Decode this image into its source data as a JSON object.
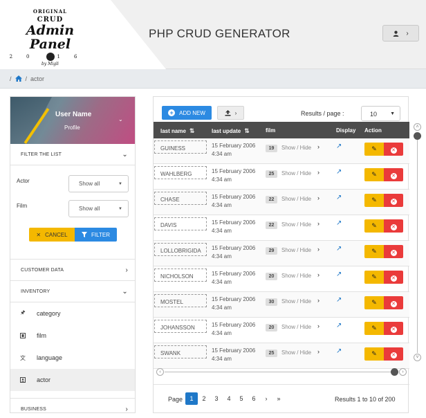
{
  "logo": {
    "top": "ORIGINAL",
    "crud": "CRUD",
    "admin": "Admin Panel",
    "year_left": "20",
    "year_right": "16",
    "by": "by Migli"
  },
  "header": {
    "title": "PHP CRUD GENERATOR",
    "user_icon": "user-icon",
    "arrow": "›"
  },
  "breadcrumb": {
    "separator": "/",
    "home_icon": "home-icon",
    "current": "actor"
  },
  "sidebar": {
    "user_name": "User Name",
    "profile": "Profile",
    "filter_title": "FILTER THE LIST",
    "filters": [
      {
        "label": "Actor",
        "value": "Show all"
      },
      {
        "label": "Film",
        "value": "Show all"
      }
    ],
    "cancel_label": "CANCEL",
    "filter_label": "FILTER",
    "customer_data": "CUSTOMER DATA",
    "inventory": "INVENTORY",
    "inventory_items": [
      {
        "label": "category",
        "icon": "pin-icon"
      },
      {
        "label": "film",
        "icon": "film-icon"
      },
      {
        "label": "language",
        "icon": "language-icon"
      },
      {
        "label": "actor",
        "icon": "contact-card-icon"
      }
    ],
    "business": "BUSINESS"
  },
  "toolbar": {
    "add_new": "ADD NEW",
    "results_per_page_label": "Results / page :",
    "results_per_page_value": "10"
  },
  "table": {
    "columns": [
      "last name",
      "last update",
      "film",
      "Display",
      "Action"
    ],
    "rows": [
      {
        "last_name": "GUINESS",
        "date": "15 February 2006",
        "time": "4:34 am",
        "film_count": "19",
        "show_hide": "Show / Hide"
      },
      {
        "last_name": "WAHLBERG",
        "date": "15 February 2006",
        "time": "4:34 am",
        "film_count": "25",
        "show_hide": "Show / Hide"
      },
      {
        "last_name": "CHASE",
        "date": "15 February 2006",
        "time": "4:34 am",
        "film_count": "22",
        "show_hide": "Show / Hide"
      },
      {
        "last_name": "DAVIS",
        "date": "15 February 2006",
        "time": "4:34 am",
        "film_count": "22",
        "show_hide": "Show / Hide"
      },
      {
        "last_name": "LOLLOBRIGIDA",
        "date": "15 February 2006",
        "time": "4:34 am",
        "film_count": "29",
        "show_hide": "Show / Hide"
      },
      {
        "last_name": "NICHOLSON",
        "date": "15 February 2006",
        "time": "4:34 am",
        "film_count": "20",
        "show_hide": "Show / Hide"
      },
      {
        "last_name": "MOSTEL",
        "date": "15 February 2006",
        "time": "4:34 am",
        "film_count": "30",
        "show_hide": "Show / Hide"
      },
      {
        "last_name": "JOHANSSON",
        "date": "15 February 2006",
        "time": "4:34 am",
        "film_count": "20",
        "show_hide": "Show / Hide"
      },
      {
        "last_name": "SWANK",
        "date": "15 February 2006",
        "time": "4:34 am",
        "film_count": "25",
        "show_hide": "Show / Hide"
      }
    ]
  },
  "pagination": {
    "label": "Page",
    "pages": [
      "1",
      "2",
      "3",
      "4",
      "5",
      "6"
    ],
    "next": "›",
    "last": "»",
    "current": "1",
    "info": "Results 1 to 10 of 200"
  },
  "colors": {
    "primary": "#2c8ae2",
    "warning": "#f4b800",
    "danger": "#ea3b3b",
    "table_header": "#4c4c4c"
  }
}
